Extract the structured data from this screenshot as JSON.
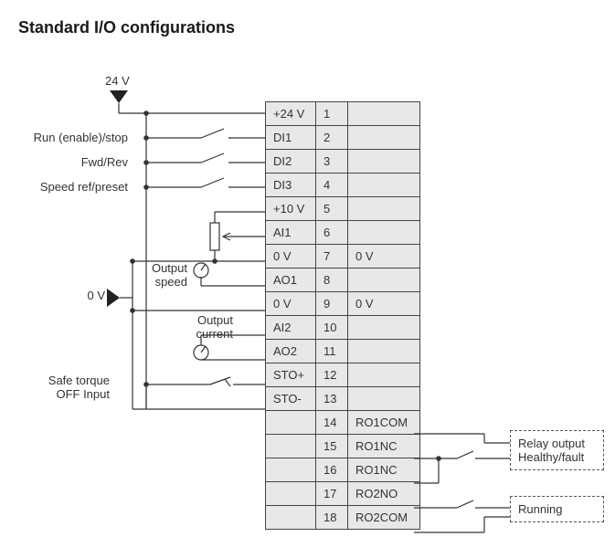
{
  "title": "Standard I/O configurations",
  "supply": {
    "v24": "24 V",
    "v0": "0 V"
  },
  "left_labels": {
    "run": "Run (enable)/stop",
    "fwd": "Fwd/Rev",
    "speed": "Speed ref/preset",
    "out_speed": "Output\nspeed",
    "out_current": "Output\ncurrent",
    "sto": "Safe torque\nOFF Input"
  },
  "relay_labels": {
    "healthy": "Relay output\nHealthy/fault",
    "running": "Running"
  },
  "terminals": [
    {
      "sig": "+24 V",
      "n": "1",
      "note": ""
    },
    {
      "sig": "DI1",
      "n": "2",
      "note": ""
    },
    {
      "sig": "DI2",
      "n": "3",
      "note": ""
    },
    {
      "sig": "DI3",
      "n": "4",
      "note": ""
    },
    {
      "sig": "+10 V",
      "n": "5",
      "note": ""
    },
    {
      "sig": "AI1",
      "n": "6",
      "note": ""
    },
    {
      "sig": "0 V",
      "n": "7",
      "note": "0 V"
    },
    {
      "sig": "AO1",
      "n": "8",
      "note": ""
    },
    {
      "sig": "0 V",
      "n": "9",
      "note": "0 V"
    },
    {
      "sig": "AI2",
      "n": "10",
      "note": ""
    },
    {
      "sig": "AO2",
      "n": "11",
      "note": ""
    },
    {
      "sig": "STO+",
      "n": "12",
      "note": ""
    },
    {
      "sig": "STO-",
      "n": "13",
      "note": ""
    },
    {
      "sig": "",
      "n": "14",
      "note": "RO1COM"
    },
    {
      "sig": "",
      "n": "15",
      "note": "RO1NC"
    },
    {
      "sig": "",
      "n": "16",
      "note": "RO1NC"
    },
    {
      "sig": "",
      "n": "17",
      "note": "RO2NO"
    },
    {
      "sig": "",
      "n": "18",
      "note": "RO2COM"
    }
  ]
}
